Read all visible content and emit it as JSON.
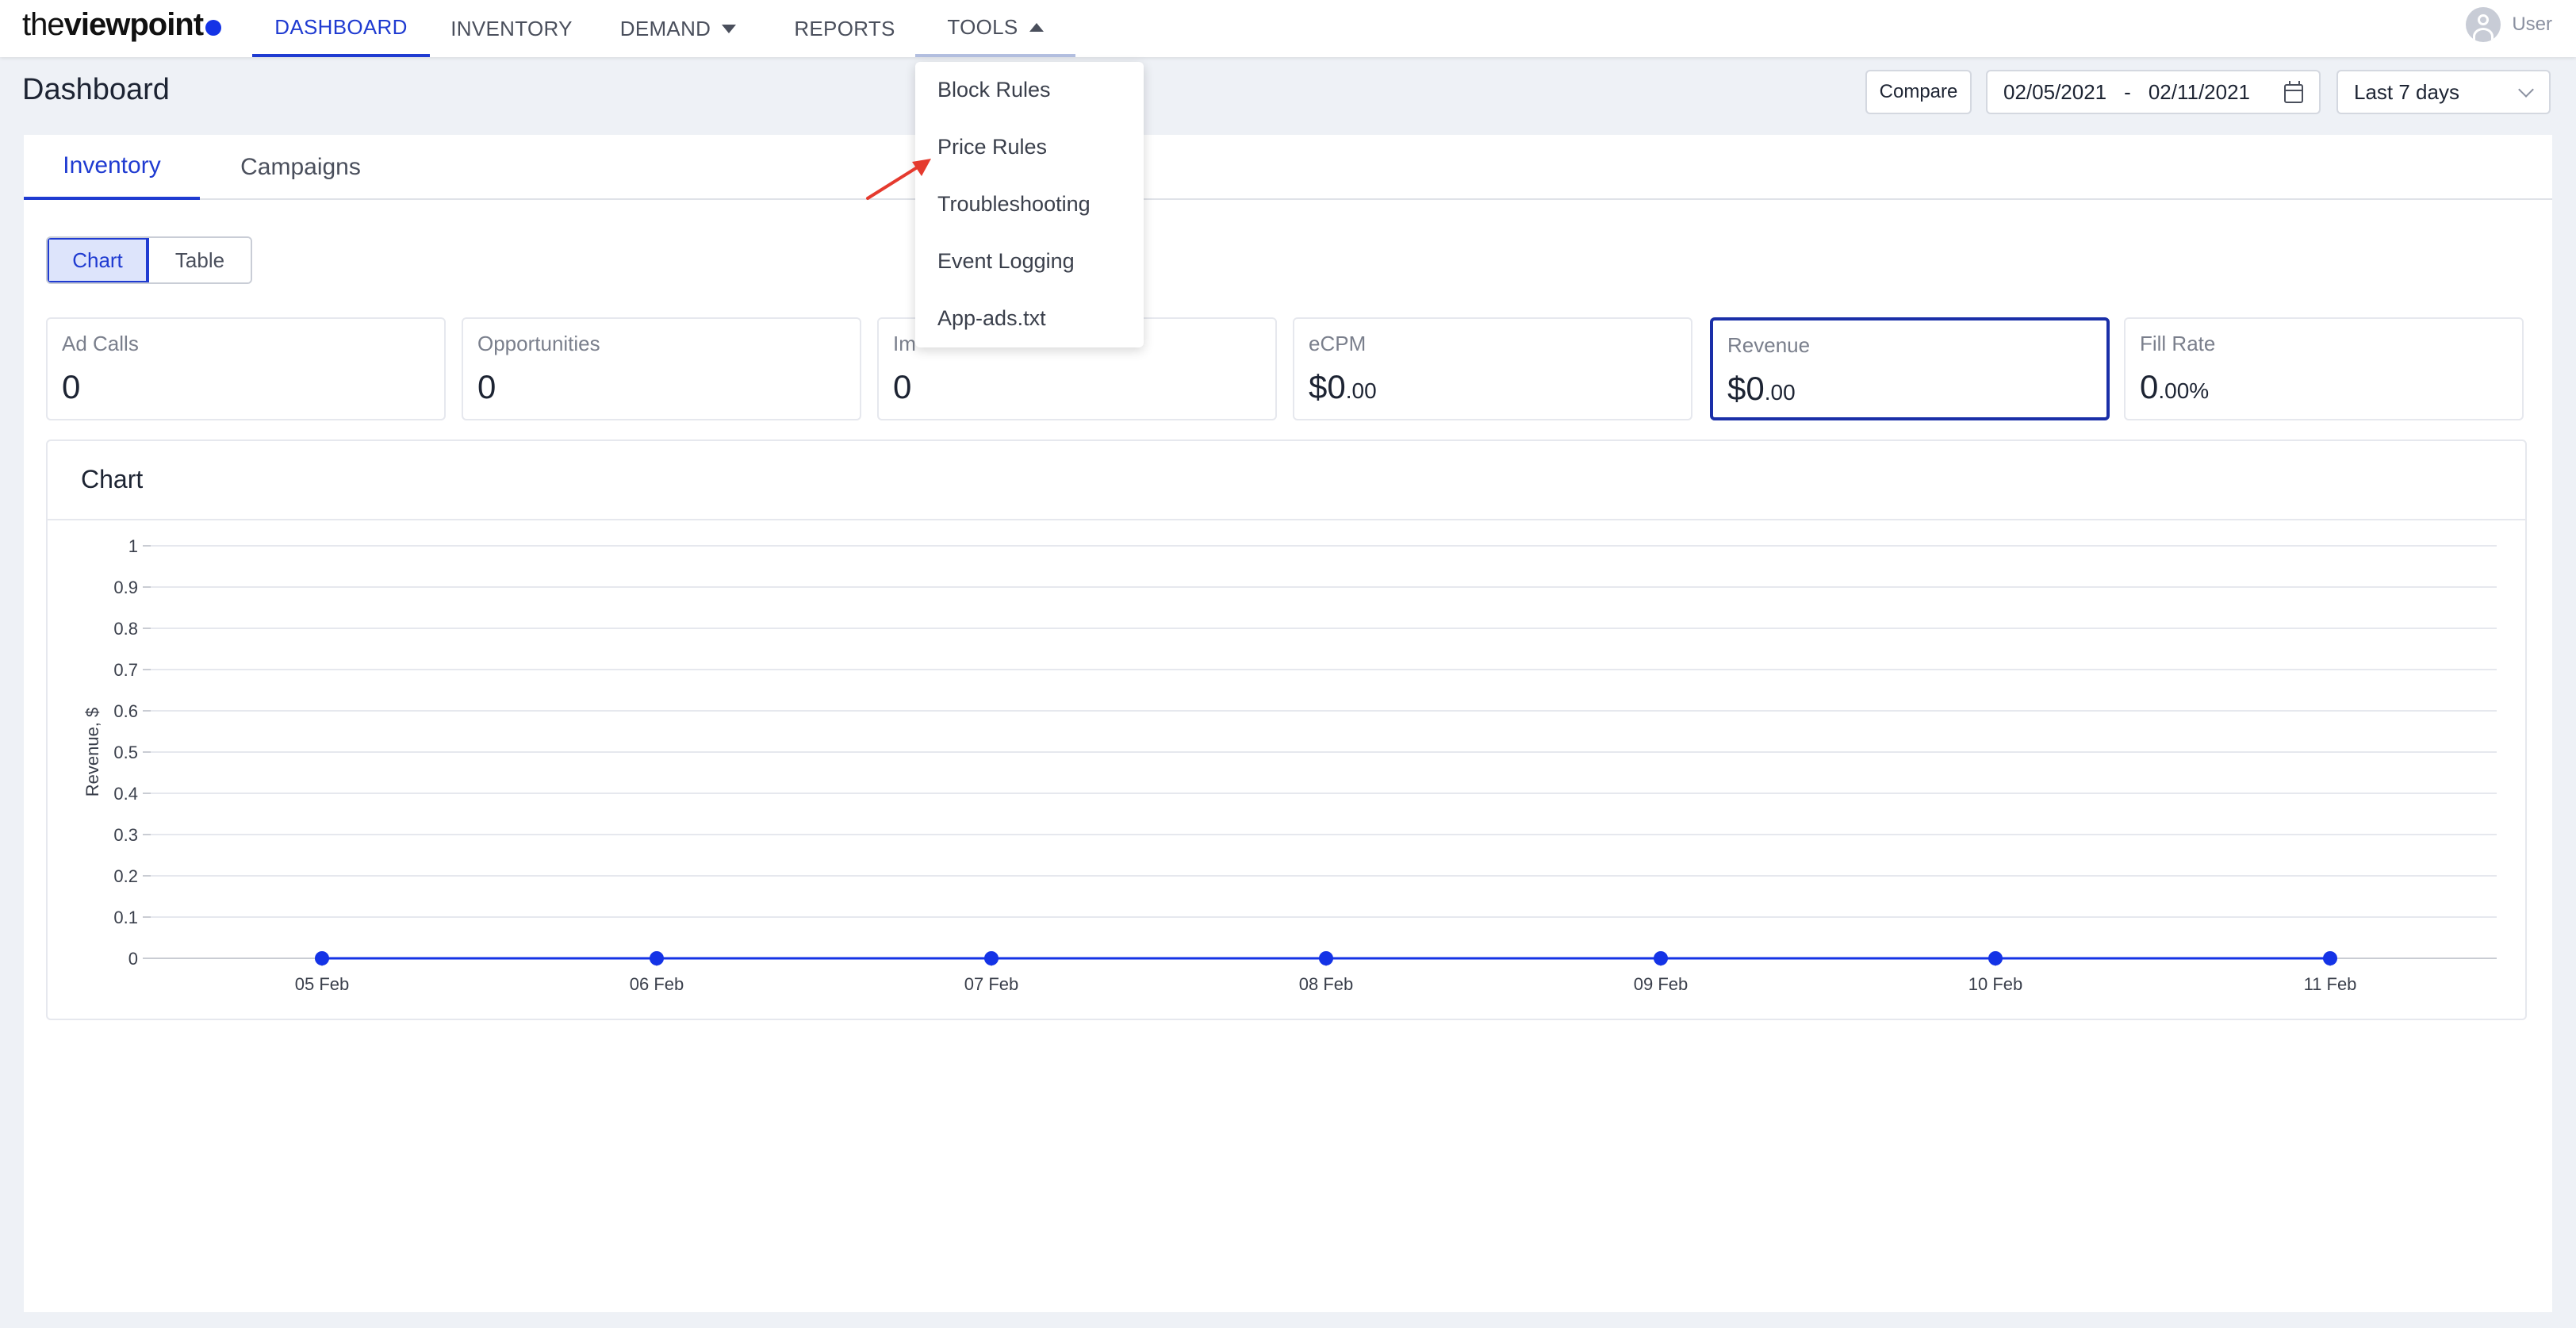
{
  "brand": {
    "logo_light": "the",
    "logo_bold": "viewpoint"
  },
  "nav": {
    "dashboard": "DASHBOARD",
    "inventory": "INVENTORY",
    "demand": "DEMAND",
    "reports": "REPORTS",
    "tools": "TOOLS"
  },
  "user": {
    "label": "User"
  },
  "header": {
    "title": "Dashboard",
    "compare": "Compare",
    "date_from": "02/05/2021",
    "date_sep": "-",
    "date_to": "02/11/2021",
    "period": "Last 7 days"
  },
  "tabs": {
    "inventory": "Inventory",
    "campaigns": "Campaigns"
  },
  "view_toggle": {
    "chart": "Chart",
    "table": "Table",
    "selected": "Chart"
  },
  "metrics": [
    {
      "label": "Ad Calls",
      "value": "0",
      "suffix": ""
    },
    {
      "label": "Opportunities",
      "value": "0",
      "suffix": ""
    },
    {
      "label": "Im",
      "value": "0",
      "suffix": ""
    },
    {
      "label": "eCPM",
      "value": "$0",
      "suffix": ".00"
    },
    {
      "label": "Revenue",
      "value": "$0",
      "suffix": ".00"
    },
    {
      "label": "Fill Rate",
      "value": "0",
      "suffix": ".00%"
    }
  ],
  "selected_metric": "Revenue",
  "tools_menu": [
    "Block Rules",
    "Price Rules",
    "Troubleshooting",
    "Event Logging",
    "App-ads.txt"
  ],
  "chart_panel_title": "Chart",
  "chart_data": {
    "type": "line",
    "categories": [
      "05 Feb",
      "06 Feb",
      "07 Feb",
      "08 Feb",
      "09 Feb",
      "10 Feb",
      "11 Feb"
    ],
    "series": [
      {
        "values": [
          0,
          0,
          0,
          0,
          0,
          0,
          0
        ]
      }
    ],
    "ylabel": "Revenue, $",
    "ylim": [
      0,
      1
    ],
    "yticks": [
      "0",
      "0.1",
      "0.2",
      "0.3",
      "0.4",
      "0.5",
      "0.6",
      "0.7",
      "0.8",
      "0.9",
      "1"
    ],
    "grid": true,
    "color": "#1433e6"
  },
  "colors": {
    "accent": "#1f3bd1",
    "annotation_arrow": "#e53a2e"
  }
}
